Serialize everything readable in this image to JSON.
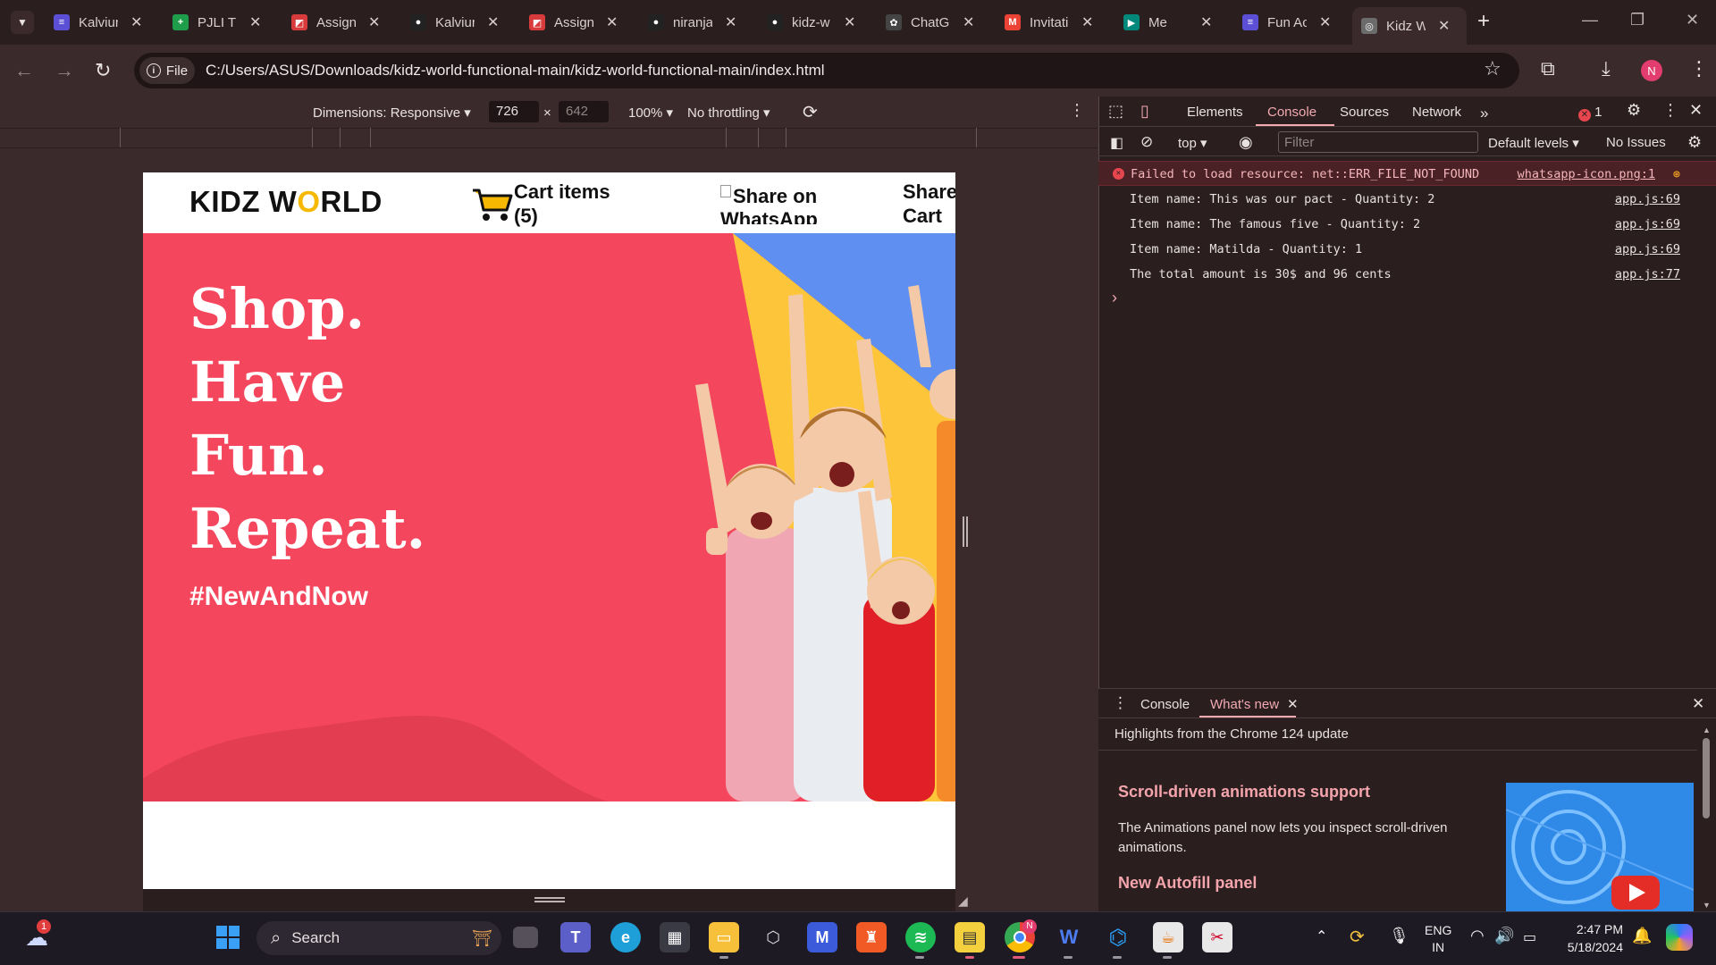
{
  "browser": {
    "tabs": [
      {
        "title": "Kalviur",
        "color": "#5b4fd6",
        "glyph": "≡"
      },
      {
        "title": "PJLI TN",
        "color": "#1e9e4a",
        "glyph": "+"
      },
      {
        "title": "Assign",
        "color": "#d83b3b",
        "glyph": "◩"
      },
      {
        "title": "Kalviur",
        "color": "#222222",
        "glyph": "●"
      },
      {
        "title": "Assign",
        "color": "#d83b3b",
        "glyph": "◩"
      },
      {
        "title": "niranja",
        "color": "#222222",
        "glyph": "●"
      },
      {
        "title": "kidz-w",
        "color": "#222222",
        "glyph": "●"
      },
      {
        "title": "ChatGl",
        "color": "#444444",
        "glyph": "✿"
      },
      {
        "title": "Invitati",
        "color": "#ea4335",
        "glyph": "M"
      },
      {
        "title": "Me",
        "color": "#00897b",
        "glyph": "▶"
      },
      {
        "title": "Fun Ac",
        "color": "#5b4fd6",
        "glyph": "≡"
      },
      {
        "title": "Kidz W",
        "color": "#6b6b6b",
        "glyph": "◎"
      }
    ],
    "new_tab": "+",
    "file_chip": "File",
    "url": "C:/Users/ASUS/Downloads/kidz-world-functional-main/kidz-world-functional-main/index.html",
    "profile_initial": "N"
  },
  "device_toolbar": {
    "dimensions_label": "Dimensions: Responsive ▾",
    "width": "726",
    "times": "×",
    "height": "642",
    "zoom": "100% ▾",
    "throttling": "No throttling ▾"
  },
  "site": {
    "logo_pre": "KIDZ W",
    "logo_o": "O",
    "logo_post": "RLD",
    "cart_line1": "Cart items",
    "cart_line2": "(5)",
    "share_whatsapp": "Share on WhatsApp",
    "share_cart_line1": "Share",
    "share_cart_line2": "Cart",
    "hero_lines": [
      "Shop.",
      "Have",
      "Fun.",
      "Repeat."
    ],
    "hashtag": "#NewAndNow"
  },
  "devtools": {
    "tabs": [
      "Elements",
      "Console",
      "Sources",
      "Network"
    ],
    "active_tab": "Console",
    "error_count": "1",
    "context": "top ▾",
    "filter_placeholder": "Filter",
    "levels": "Default levels ▾",
    "issues": "No Issues",
    "logs": [
      {
        "type": "error",
        "text": "Failed to load resource: net::ERR_FILE_NOT_FOUND",
        "source": "whatsapp-icon.png:1"
      },
      {
        "type": "log",
        "text": "Item name: This was our pact - Quantity: 2",
        "source": "app.js:69"
      },
      {
        "type": "log",
        "text": "Item name: The famous five - Quantity: 2",
        "source": "app.js:69"
      },
      {
        "type": "log",
        "text": "Item name: Matilda - Quantity: 1",
        "source": "app.js:69"
      },
      {
        "type": "log",
        "text": "The total amount is 30$ and 96 cents",
        "source": "app.js:77"
      }
    ],
    "prompt": "›",
    "drawer": {
      "tabs": [
        "Console",
        "What's new"
      ],
      "active_tab": "What's new",
      "heading": "Highlights from the Chrome 124 update",
      "item1_title": "Scroll-driven animations support",
      "item1_body": "The Animations panel now lets you inspect scroll-driven animations.",
      "item2_title": "New Autofill panel"
    }
  },
  "taskbar": {
    "weather_badge": "1",
    "search": "Search",
    "tray_lang1": "ENG",
    "tray_lang2": "IN",
    "time": "2:47 PM",
    "date": "5/18/2024",
    "chrome_badge": "N"
  }
}
